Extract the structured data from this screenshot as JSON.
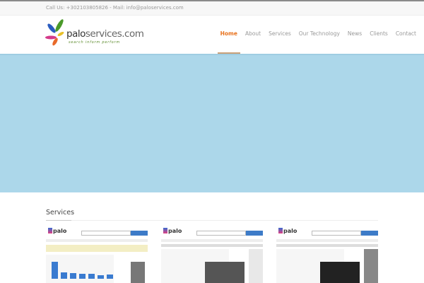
{
  "topbar": {
    "contact": "Call Us: +302103805826 - Mail: info@paloservices.com"
  },
  "logo": {
    "name_bold": "palo",
    "name_rest": "services.com",
    "tagline": "search inform perform"
  },
  "nav": [
    "Home",
    "About",
    "Services",
    "Our Technology",
    "News",
    "Clients",
    "Contact"
  ],
  "nav_active": "Home",
  "colors": {
    "accent": "#e8731f",
    "hero": "#acd7ea"
  },
  "services": {
    "title": "Services",
    "thumbs": [
      {
        "logo": "palo"
      },
      {
        "logo": "palo"
      },
      {
        "logo": "palo"
      }
    ]
  }
}
